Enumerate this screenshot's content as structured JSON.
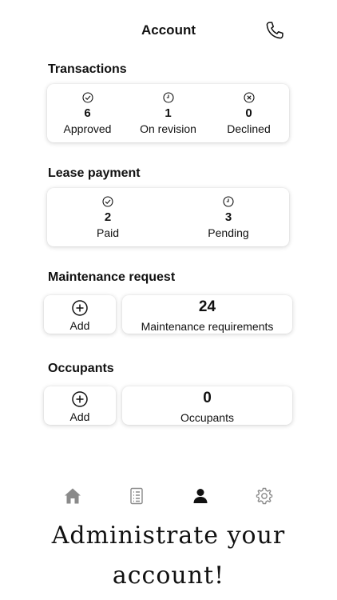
{
  "header": {
    "title": "Account",
    "call_icon": "phone-icon"
  },
  "transactions": {
    "title": "Transactions",
    "items": [
      {
        "icon": "check-circle-icon",
        "value": "6",
        "label": "Approved"
      },
      {
        "icon": "clock-icon",
        "value": "1",
        "label": "On revision"
      },
      {
        "icon": "x-circle-icon",
        "value": "0",
        "label": "Declined"
      }
    ]
  },
  "lease_payment": {
    "title": "Lease payment",
    "items": [
      {
        "icon": "check-circle-icon",
        "value": "2",
        "label": "Paid"
      },
      {
        "icon": "clock-icon",
        "value": "3",
        "label": "Pending"
      }
    ]
  },
  "maintenance": {
    "title": "Maintenance request",
    "add_label": "Add",
    "count": "24",
    "count_label": "Maintenance requirements"
  },
  "occupants": {
    "title": "Occupants",
    "add_label": "Add",
    "count": "0",
    "count_label": "Occupants"
  },
  "tabbar": {
    "items": [
      {
        "icon": "home-icon",
        "active": false
      },
      {
        "icon": "document-list-icon",
        "active": false
      },
      {
        "icon": "person-icon",
        "active": true
      },
      {
        "icon": "gear-icon",
        "active": false
      }
    ]
  },
  "tagline": {
    "line1": "Administrate your",
    "line2": "account!"
  },
  "colors": {
    "text": "#111111",
    "inactive_tab": "#8a8a8a",
    "card_bg": "#ffffff"
  }
}
